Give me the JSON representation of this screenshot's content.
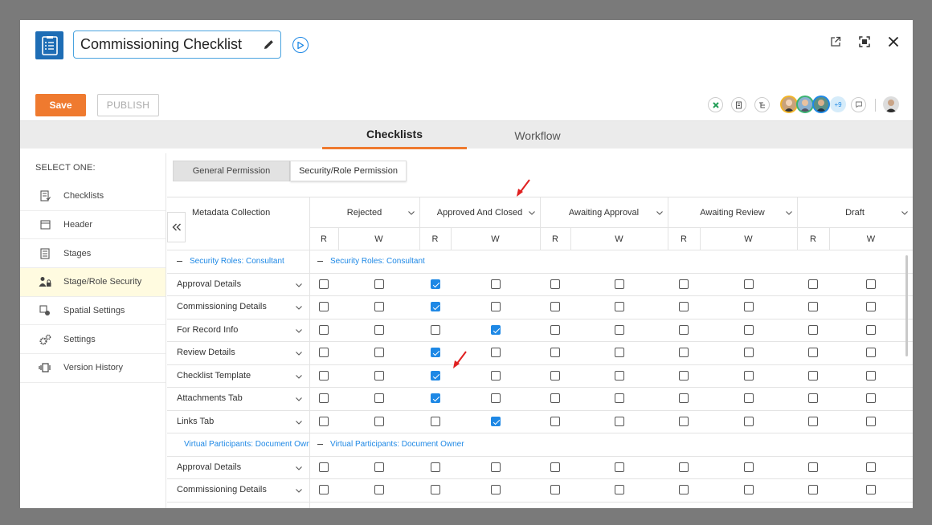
{
  "app": {
    "title": "Commissioning Checklist",
    "icon": "checklist-icon"
  },
  "window_controls": [
    "external-link-icon",
    "fullscreen-icon",
    "close-icon"
  ],
  "toolbar": {
    "save_label": "Save",
    "publish_label": "PUBLISH",
    "more_avatars": "+9"
  },
  "tabs": {
    "checklists": "Checklists",
    "workflow": "Workflow",
    "active": "Checklists"
  },
  "sidebar": {
    "heading": "SELECT ONE:",
    "items": [
      {
        "label": "Checklists",
        "icon": "checklist-icon"
      },
      {
        "label": "Header",
        "icon": "header-icon"
      },
      {
        "label": "Stages",
        "icon": "stages-icon"
      },
      {
        "label": "Stage/Role Security",
        "icon": "user-lock-icon",
        "active": true
      },
      {
        "label": "Spatial Settings",
        "icon": "spatial-settings-icon"
      },
      {
        "label": "Settings",
        "icon": "gears-icon"
      },
      {
        "label": "Version History",
        "icon": "version-history-icon"
      }
    ]
  },
  "permission_tabs": {
    "general": "General Permission",
    "security": "Security/Role Permission"
  },
  "grid": {
    "first_column": "Metadata Collection",
    "read_label": "R",
    "write_label": "W",
    "columns": [
      "Rejected",
      "Approved And Closed",
      "Awaiting Approval",
      "Awaiting Review",
      "Draft"
    ],
    "groups": [
      {
        "label": "Security Roles: Consultant",
        "right_label": "Security Roles: Consultant",
        "rows": [
          {
            "name": "Approval Details",
            "checks": [
              false,
              false,
              true,
              false,
              false,
              false,
              false,
              false,
              false,
              false
            ]
          },
          {
            "name": "Commissioning Details",
            "checks": [
              false,
              false,
              true,
              false,
              false,
              false,
              false,
              false,
              false,
              false
            ]
          },
          {
            "name": "For Record Info",
            "checks": [
              false,
              false,
              false,
              true,
              false,
              false,
              false,
              false,
              false,
              false
            ]
          },
          {
            "name": "Review Details",
            "checks": [
              false,
              false,
              true,
              false,
              false,
              false,
              false,
              false,
              false,
              false
            ]
          },
          {
            "name": "Checklist Template",
            "checks": [
              false,
              false,
              true,
              false,
              false,
              false,
              false,
              false,
              false,
              false
            ]
          },
          {
            "name": "Attachments Tab",
            "checks": [
              false,
              false,
              true,
              false,
              false,
              false,
              false,
              false,
              false,
              false
            ]
          },
          {
            "name": "Links Tab",
            "checks": [
              false,
              false,
              false,
              true,
              false,
              false,
              false,
              false,
              false,
              false
            ]
          }
        ]
      },
      {
        "label": "Virtual Participants: Document Owner",
        "right_label": "Virtual Participants: Document Owner",
        "rows": [
          {
            "name": "Approval Details",
            "checks": [
              false,
              false,
              false,
              false,
              false,
              false,
              false,
              false,
              false,
              false
            ]
          },
          {
            "name": "Commissioning Details",
            "checks": [
              false,
              false,
              false,
              false,
              false,
              false,
              false,
              false,
              false,
              false
            ]
          },
          {
            "name": "",
            "checks": [
              false,
              false,
              false,
              false,
              false,
              false,
              false,
              false,
              false,
              false
            ]
          }
        ]
      }
    ]
  },
  "colors": {
    "accent": "#ef7a2f",
    "primary": "#1e88e5",
    "annotation": "#e02020"
  }
}
